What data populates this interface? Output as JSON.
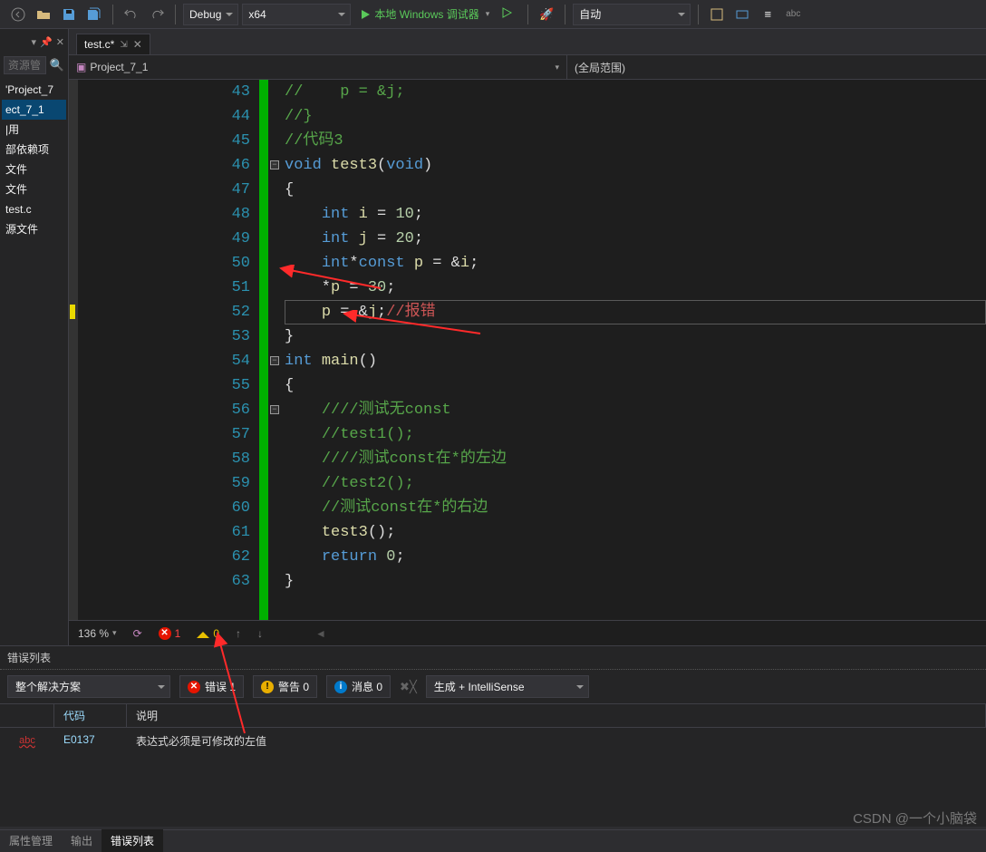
{
  "toolbar": {
    "config": "Debug",
    "platform": "x64",
    "start_label": "本地 Windows 调试器",
    "auto_label": "自动"
  },
  "sidebar": {
    "search_placeholder": "资源管",
    "items": [
      "'Project_7",
      "ect_7_1",
      "|用",
      "部依赖项",
      "文件",
      "文件",
      "test.c",
      "源文件"
    ]
  },
  "tab": {
    "label": "test.c*"
  },
  "nav": {
    "scope": "Project_7_1",
    "func": "(全局范围)"
  },
  "code": {
    "lines": [
      {
        "n": 43,
        "seg": [
          [
            "c-com",
            "//    p = &j;"
          ]
        ]
      },
      {
        "n": 44,
        "seg": [
          [
            "c-com",
            "//}"
          ]
        ]
      },
      {
        "n": 45,
        "seg": [
          [
            "c-com",
            "//代码3"
          ]
        ]
      },
      {
        "n": 46,
        "seg": [
          [
            "c-kw",
            "void"
          ],
          [
            "c-plain",
            " "
          ],
          [
            "c-fn",
            "test3"
          ],
          [
            "c-plain",
            "("
          ],
          [
            "c-kw",
            "void"
          ],
          [
            "c-plain",
            ")"
          ]
        ],
        "fold": "-"
      },
      {
        "n": 47,
        "seg": [
          [
            "c-plain",
            "{"
          ]
        ]
      },
      {
        "n": 48,
        "seg": [
          [
            "c-plain",
            "    "
          ],
          [
            "c-kw",
            "int"
          ],
          [
            "c-plain",
            " "
          ],
          [
            "c-id",
            "i"
          ],
          [
            "c-plain",
            " = "
          ],
          [
            "c-num",
            "10"
          ],
          [
            "c-plain",
            ";"
          ]
        ]
      },
      {
        "n": 49,
        "seg": [
          [
            "c-plain",
            "    "
          ],
          [
            "c-kw",
            "int"
          ],
          [
            "c-plain",
            " "
          ],
          [
            "c-id",
            "j"
          ],
          [
            "c-plain",
            " = "
          ],
          [
            "c-num",
            "20"
          ],
          [
            "c-plain",
            ";"
          ]
        ]
      },
      {
        "n": 50,
        "seg": [
          [
            "c-plain",
            "    "
          ],
          [
            "c-kw",
            "int"
          ],
          [
            "c-plain",
            "*"
          ],
          [
            "c-kw",
            "const"
          ],
          [
            "c-plain",
            " "
          ],
          [
            "c-id",
            "p"
          ],
          [
            "c-plain",
            " = &"
          ],
          [
            "c-id",
            "i"
          ],
          [
            "c-plain",
            ";"
          ]
        ]
      },
      {
        "n": 51,
        "seg": [
          [
            "c-plain",
            "    *"
          ],
          [
            "c-id",
            "p"
          ],
          [
            "c-plain",
            " = "
          ],
          [
            "c-num",
            "30"
          ],
          [
            "c-plain",
            ";"
          ]
        ]
      },
      {
        "n": 52,
        "seg": [
          [
            "c-plain",
            "    "
          ],
          [
            "c-id",
            "p"
          ],
          [
            "c-plain",
            " = &"
          ],
          [
            "c-id",
            "j"
          ],
          [
            "c-plain",
            ";"
          ],
          [
            "c-cmt2",
            "//报错"
          ]
        ],
        "bp": true
      },
      {
        "n": 53,
        "seg": [
          [
            "c-plain",
            "}"
          ]
        ]
      },
      {
        "n": 54,
        "seg": [
          [
            "c-kw",
            "int"
          ],
          [
            "c-plain",
            " "
          ],
          [
            "c-fn",
            "main"
          ],
          [
            "c-plain",
            "()"
          ]
        ],
        "fold": "-"
      },
      {
        "n": 55,
        "seg": [
          [
            "c-plain",
            "{"
          ]
        ]
      },
      {
        "n": 56,
        "seg": [
          [
            "c-plain",
            "    "
          ],
          [
            "c-com",
            "////测试无const"
          ]
        ],
        "fold": "-"
      },
      {
        "n": 57,
        "seg": [
          [
            "c-plain",
            "    "
          ],
          [
            "c-com",
            "//test1();"
          ]
        ]
      },
      {
        "n": 58,
        "seg": [
          [
            "c-plain",
            "    "
          ],
          [
            "c-com",
            "////测试const在*的左边"
          ]
        ]
      },
      {
        "n": 59,
        "seg": [
          [
            "c-plain",
            "    "
          ],
          [
            "c-com",
            "//test2();"
          ]
        ]
      },
      {
        "n": 60,
        "seg": [
          [
            "c-plain",
            "    "
          ],
          [
            "c-com",
            "//测试const在*的右边"
          ]
        ]
      },
      {
        "n": 61,
        "seg": [
          [
            "c-plain",
            "    "
          ],
          [
            "c-fn",
            "test3"
          ],
          [
            "c-plain",
            "();"
          ]
        ]
      },
      {
        "n": 62,
        "seg": [
          [
            "c-plain",
            "    "
          ],
          [
            "c-kw",
            "return"
          ],
          [
            "c-plain",
            " "
          ],
          [
            "c-num",
            "0"
          ],
          [
            "c-plain",
            ";"
          ]
        ]
      },
      {
        "n": 63,
        "seg": [
          [
            "c-plain",
            "}"
          ]
        ]
      }
    ],
    "current_line": 52
  },
  "status": {
    "zoom": "136 %",
    "errors": "1",
    "warnings": "0"
  },
  "error_panel": {
    "title": "错误列表",
    "scope": "整个解决方案",
    "filter_error": "错误 1",
    "filter_warn": "警告 0",
    "filter_info": "消息 0",
    "source": "生成 + IntelliSense",
    "col_code": "代码",
    "col_desc": "说明",
    "rows": [
      {
        "code": "E0137",
        "desc": "表达式必须是可修改的左值"
      }
    ]
  },
  "bottom_tabs": {
    "t1": "属性管理",
    "t2": "输出",
    "t3": "错误列表"
  },
  "watermark": "CSDN @一个小脑袋"
}
